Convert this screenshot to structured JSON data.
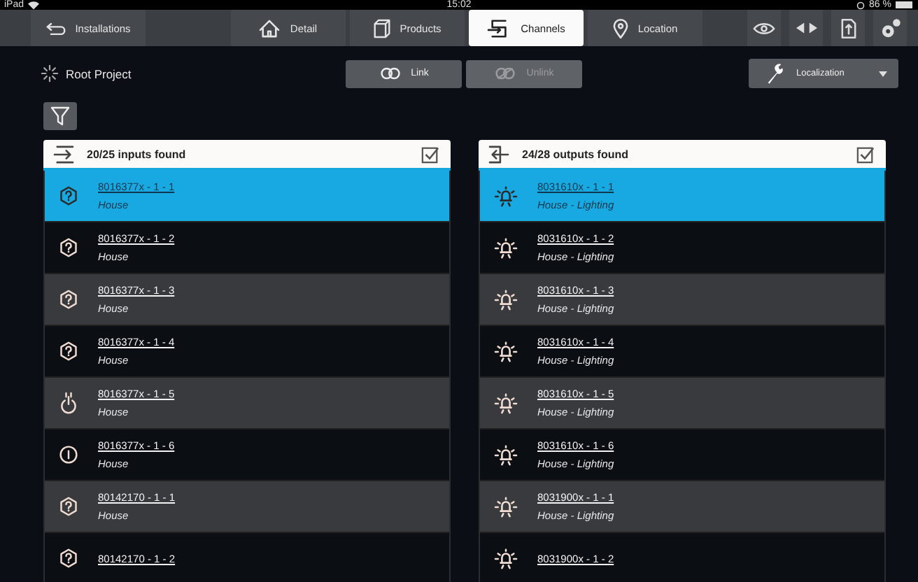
{
  "status_bar": {
    "device": "iPad",
    "time": "15:02",
    "battery": "86 %"
  },
  "toolbar": {
    "back": {
      "label": "Installations"
    },
    "tabs": [
      {
        "label": "Detail",
        "kind": "house",
        "selected": false
      },
      {
        "label": "Products",
        "kind": "cube",
        "selected": false
      },
      {
        "label": "Channels",
        "kind": "channels",
        "selected": true
      },
      {
        "label": "Location",
        "kind": "pin",
        "selected": false
      }
    ],
    "actions": [
      {
        "kind": "eye"
      },
      {
        "kind": "arrows"
      },
      {
        "kind": "document"
      },
      {
        "kind": "gear"
      }
    ]
  },
  "project": {
    "title": "Root Project"
  },
  "link_buttons": [
    {
      "label": "Link",
      "disabled": false
    },
    {
      "label": "Unlink",
      "disabled": true
    }
  ],
  "localization": {
    "label": "Localization"
  },
  "panels": [
    {
      "kind": "inputs",
      "title": "20/25 inputs found",
      "checked": true,
      "rows": [
        {
          "title": "8016377x - 1 - 1",
          "subtitle": "House",
          "kind": "question",
          "selected": true
        },
        {
          "title": "8016377x - 1 - 2",
          "subtitle": "House",
          "kind": "question",
          "selected": false
        },
        {
          "title": "8016377x - 1 - 3",
          "subtitle": "House",
          "kind": "question",
          "selected": false
        },
        {
          "title": "8016377x - 1 - 4",
          "subtitle": "House",
          "kind": "question",
          "selected": false
        },
        {
          "title": "8016377x - 1 - 5",
          "subtitle": "House",
          "kind": "power",
          "selected": false
        },
        {
          "title": "8016377x - 1 - 6",
          "subtitle": "House",
          "kind": "info",
          "selected": false
        },
        {
          "title": "80142170 - 1 - 1",
          "subtitle": "House",
          "kind": "question",
          "selected": false
        },
        {
          "title": "80142170 - 1 - 2",
          "kind": "question",
          "selected": false
        }
      ]
    },
    {
      "kind": "outputs",
      "title": "24/28 outputs found",
      "checked": true,
      "rows": [
        {
          "title": "8031610x - 1 - 1",
          "subtitle": "House - Lighting",
          "kind": "bulb",
          "selected": true
        },
        {
          "title": "8031610x - 1 - 2",
          "subtitle": "House - Lighting",
          "kind": "bulb",
          "selected": false
        },
        {
          "title": "8031610x - 1 - 3",
          "subtitle": "House - Lighting",
          "kind": "bulb",
          "selected": false
        },
        {
          "title": "8031610x - 1 - 4",
          "subtitle": "House - Lighting",
          "kind": "bulb",
          "selected": false
        },
        {
          "title": "8031610x - 1 - 5",
          "subtitle": "House - Lighting",
          "kind": "bulb",
          "selected": false
        },
        {
          "title": "8031610x - 1 - 6",
          "subtitle": "House - Lighting",
          "kind": "bulb",
          "selected": false
        },
        {
          "title": "8031900x - 1 - 1",
          "subtitle": "House - Lighting",
          "kind": "bulb",
          "selected": false
        },
        {
          "title": "8031900x - 1 - 2",
          "kind": "bulb",
          "selected": false
        }
      ]
    }
  ]
}
